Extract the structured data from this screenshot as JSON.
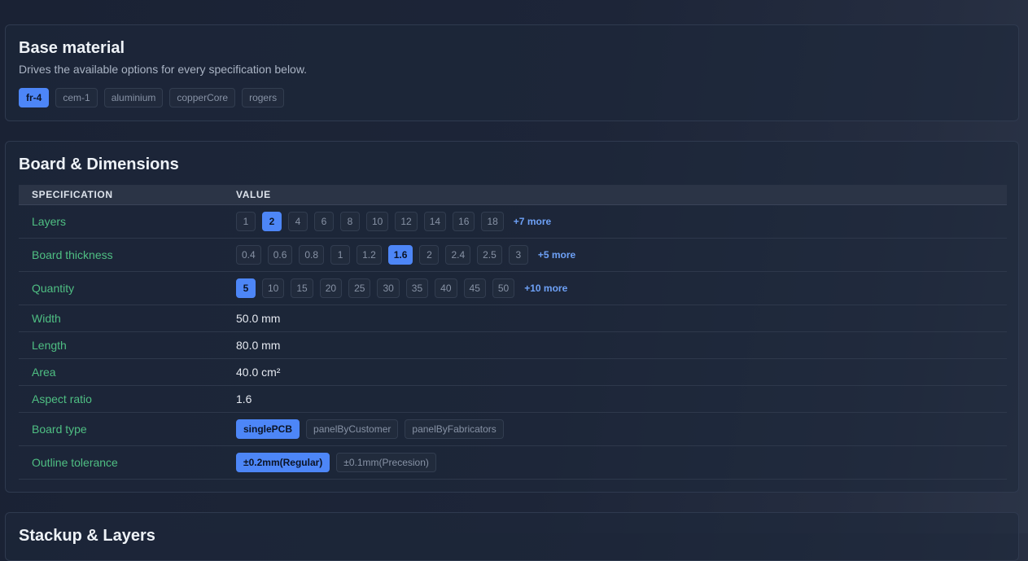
{
  "base_material": {
    "title": "Base material",
    "subtitle": "Drives the available options for every specification below.",
    "options": [
      "fr-4",
      "cem-1",
      "aluminium",
      "copperCore",
      "rogers"
    ],
    "selected": "fr-4"
  },
  "board_dimensions": {
    "title": "Board & Dimensions",
    "headers": {
      "spec": "SPECIFICATION",
      "value": "VALUE"
    },
    "rows": {
      "layers": {
        "label": "Layers",
        "options": [
          "1",
          "2",
          "4",
          "6",
          "8",
          "10",
          "12",
          "14",
          "16",
          "18"
        ],
        "selected": "2",
        "more": "+7 more"
      },
      "thickness": {
        "label": "Board thickness",
        "options": [
          "0.4",
          "0.6",
          "0.8",
          "1",
          "1.2",
          "1.6",
          "2",
          "2.4",
          "2.5",
          "3"
        ],
        "selected": "1.6",
        "more": "+5 more"
      },
      "quantity": {
        "label": "Quantity",
        "options": [
          "5",
          "10",
          "15",
          "20",
          "25",
          "30",
          "35",
          "40",
          "45",
          "50"
        ],
        "selected": "5",
        "more": "+10 more"
      },
      "width": {
        "label": "Width",
        "value": "50.0 mm"
      },
      "length": {
        "label": "Length",
        "value": "80.0 mm"
      },
      "area": {
        "label": "Area",
        "value": "40.0 cm²"
      },
      "aspect": {
        "label": "Aspect ratio",
        "value": "1.6"
      },
      "board_type": {
        "label": "Board type",
        "options": [
          "singlePCB",
          "panelByCustomer",
          "panelByFabricators"
        ],
        "selected": "singlePCB"
      },
      "outline_tolerance": {
        "label": "Outline tolerance",
        "options": [
          "±0.2mm(Regular)",
          "±0.1mm(Precesion)"
        ],
        "selected": "±0.2mm(Regular)"
      }
    }
  },
  "stackup": {
    "title": "Stackup & Layers"
  },
  "colors": {
    "accent": "#4d86f7",
    "spec_label": "#4fbf83",
    "more_link": "#6ea1f7"
  }
}
